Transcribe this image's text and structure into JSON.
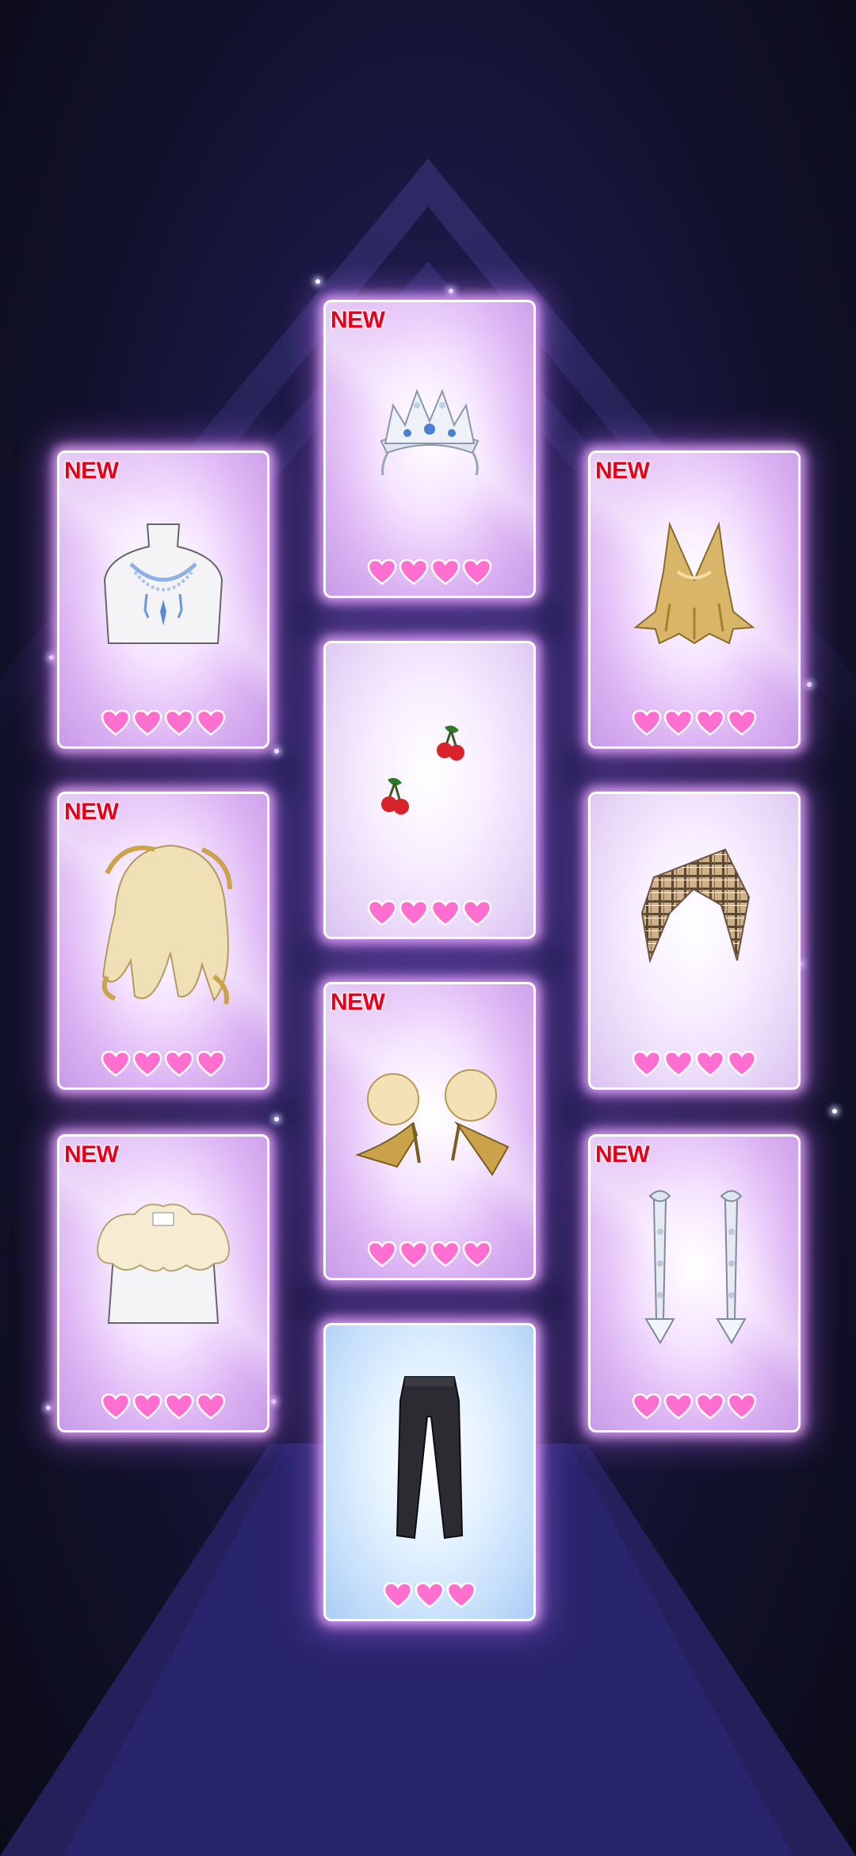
{
  "badge_label": "NEW",
  "colors": {
    "heart": "#ff6fcf",
    "heart_outline": "#ffffff",
    "badge": "#e6001c",
    "glow": "#e6aaff"
  },
  "cards": [
    {
      "name": "tiara",
      "new": true,
      "hearts": 4,
      "style": "purple"
    },
    {
      "name": "necklace",
      "new": true,
      "hearts": 4,
      "style": "purple"
    },
    {
      "name": "gold-top",
      "new": true,
      "hearts": 4,
      "style": "purple"
    },
    {
      "name": "cherry-earrings",
      "new": false,
      "hearts": 4,
      "style": "lavender"
    },
    {
      "name": "blonde-hair",
      "new": true,
      "hearts": 4,
      "style": "purple"
    },
    {
      "name": "plaid-scarf",
      "new": false,
      "hearts": 4,
      "style": "lavender"
    },
    {
      "name": "gold-pom-heels",
      "new": true,
      "hearts": 4,
      "style": "purple"
    },
    {
      "name": "ruffle-collar",
      "new": true,
      "hearts": 4,
      "style": "purple"
    },
    {
      "name": "crystal-earrings",
      "new": true,
      "hearts": 4,
      "style": "purple"
    },
    {
      "name": "black-trousers",
      "new": false,
      "hearts": 3,
      "style": "blue"
    }
  ]
}
